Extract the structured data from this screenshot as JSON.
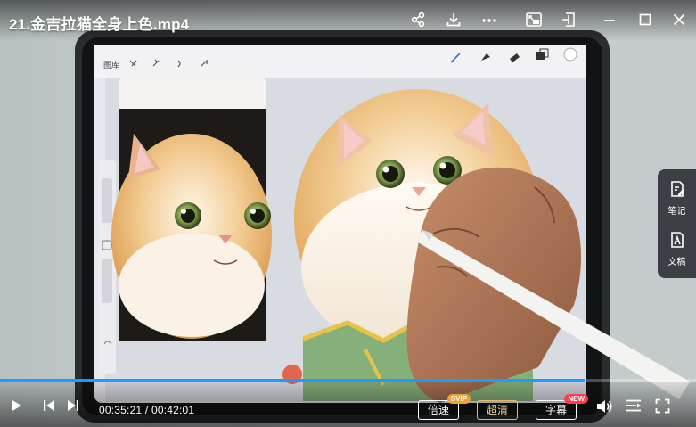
{
  "video": {
    "title": "21.金吉拉猫全身上色.mp4",
    "app_toolbar": {
      "gallery_label": "图库"
    }
  },
  "topbar": {
    "icons": [
      "share-icon",
      "download-icon",
      "more-icon",
      "picture-in-picture-icon",
      "pin-icon",
      "minimize-icon",
      "maximize-icon",
      "close-icon"
    ]
  },
  "sidepanel": {
    "notes_label": "笔记",
    "docs_label": "文稿"
  },
  "playback": {
    "progress": 0.8398,
    "current_time": "00:35:21",
    "separator": "/",
    "total_time": "00:42:01",
    "speed_label": "倍速",
    "speed_badge": "SVIP",
    "quality_label": "超清",
    "subtitle_label": "字幕",
    "subtitle_badge": "NEW"
  },
  "colors": {
    "progress_played": "#1e9bff",
    "quality_accent": "#e8b96a",
    "vip_badge": "#e8a33a",
    "new_badge": "#ff3b4c"
  }
}
